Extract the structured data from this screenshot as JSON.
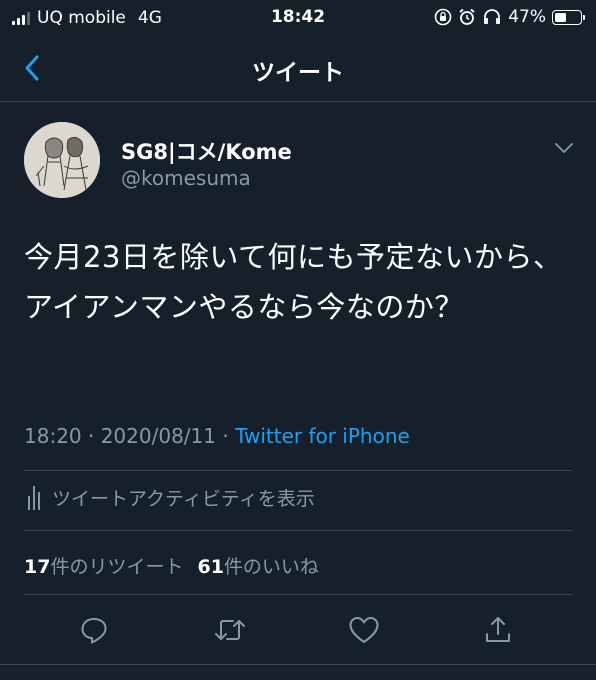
{
  "status_bar": {
    "carrier": "UQ mobile",
    "network": "4G",
    "time": "18:42",
    "battery_percent": "47%",
    "battery_level": 0.47,
    "signal_bars": 3,
    "icons": [
      "signal-icon",
      "orientation-lock-icon",
      "alarm-icon",
      "headphones-icon",
      "battery-icon"
    ]
  },
  "nav": {
    "title": "ツイート",
    "back_icon": "chevron-left-icon"
  },
  "tweet": {
    "display_name": "SG8|コメ/Kome",
    "handle": "@komesuma",
    "text": "今月23日を除いて何にも予定ないから、アイアンマンやるなら今なのか？",
    "time": "18:20",
    "date": "2020/08/11",
    "meta_prefix": "18:20 · 2020/08/11 · ",
    "source": "Twitter for iPhone"
  },
  "activity": {
    "label": "ツイートアクティビティを表示"
  },
  "stats": {
    "retweets_count": "17",
    "retweets_label": "件のリツイート",
    "likes_count": "61",
    "likes_label": "件のいいね"
  },
  "actions": [
    "reply-icon",
    "retweet-icon",
    "like-icon",
    "share-icon"
  ],
  "colors": {
    "background": "#15202b",
    "accent": "#1da1f2",
    "secondary_text": "#8899a6",
    "divider": "#38444d"
  }
}
